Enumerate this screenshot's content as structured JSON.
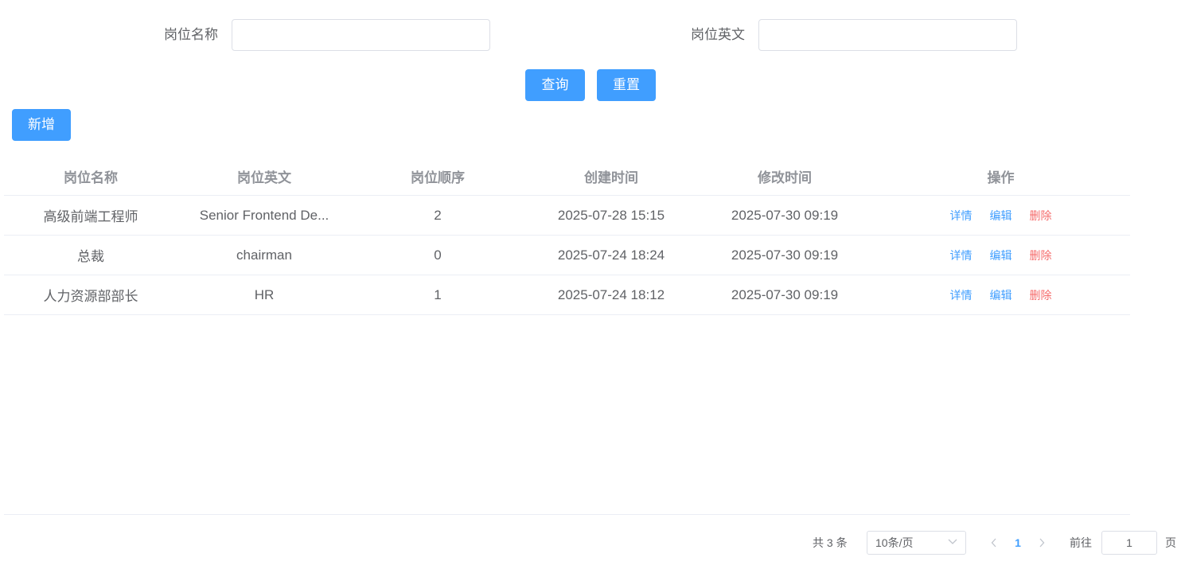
{
  "search": {
    "name_label": "岗位名称",
    "name_value": "",
    "english_label": "岗位英文",
    "english_value": "",
    "query_label": "查询",
    "reset_label": "重置"
  },
  "toolbar": {
    "add_label": "新增"
  },
  "table": {
    "headers": [
      "岗位名称",
      "岗位英文",
      "岗位顺序",
      "创建时间",
      "修改时间",
      "操作"
    ],
    "rows": [
      {
        "name": "高级前端工程师",
        "english": "Senior Frontend De...",
        "order": "2",
        "created": "2025-07-28 15:15",
        "modified": "2025-07-30 09:19"
      },
      {
        "name": "总裁",
        "english": "chairman",
        "order": "0",
        "created": "2025-07-24 18:24",
        "modified": "2025-07-30 09:19"
      },
      {
        "name": "人力资源部部长",
        "english": "HR",
        "order": "1",
        "created": "2025-07-24 18:12",
        "modified": "2025-07-30 09:19"
      }
    ],
    "actions": {
      "detail": "详情",
      "edit": "编辑",
      "delete": "删除"
    }
  },
  "pagination": {
    "total_text": "共 3 条",
    "page_size": "10条/页",
    "current_page": "1",
    "goto_label": "前往",
    "goto_value": "1",
    "page_suffix": "页"
  },
  "colors": {
    "primary": "#409eff",
    "danger": "#f56c6c",
    "border": "#dcdfe6",
    "text": "#606266",
    "header_text": "#909399"
  }
}
